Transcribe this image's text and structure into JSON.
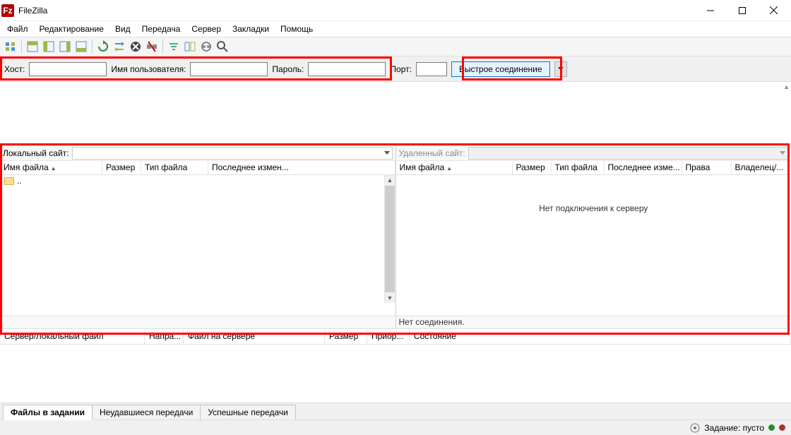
{
  "title": "FileZilla",
  "menu": [
    "Файл",
    "Редактирование",
    "Вид",
    "Передача",
    "Сервер",
    "Закладки",
    "Помощь"
  ],
  "quickconnect": {
    "host_label": "Хост:",
    "user_label": "Имя пользователя:",
    "pass_label": "Пароль:",
    "port_label": "Порт:",
    "button": "Быстрое соединение"
  },
  "local": {
    "site_label": "Локальный сайт:",
    "columns": [
      "Имя файла",
      "Размер",
      "Тип файла",
      "Последнее измен..."
    ],
    "updir": ".."
  },
  "remote": {
    "site_label": "Удаленный сайт:",
    "columns": [
      "Имя файла",
      "Размер",
      "Тип файла",
      "Последнее изме...",
      "Права",
      "Владелец/..."
    ],
    "no_server": "Нет подключения к серверу",
    "footer": "Нет соединения."
  },
  "queue": {
    "columns": [
      "Сервер/Локальный файл",
      "Напра...",
      "Файл на сервере",
      "Размер",
      "Приор...",
      "Состояние"
    ]
  },
  "tabs": [
    "Файлы в задании",
    "Неудавшиеся передачи",
    "Успешные передачи"
  ],
  "status": {
    "queue": "Задание: пусто"
  }
}
